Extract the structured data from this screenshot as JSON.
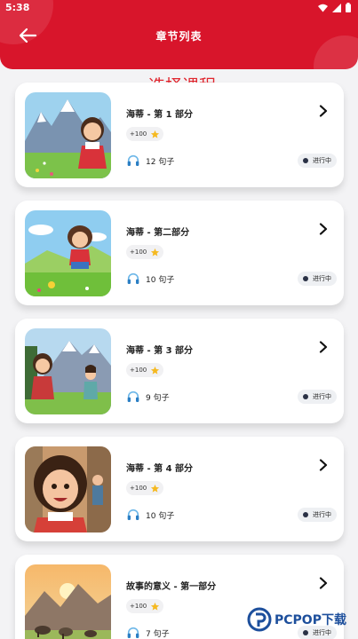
{
  "status": {
    "time": "5:38"
  },
  "header": {
    "title": "章节列表",
    "overlay": "选择课程"
  },
  "lessons": [
    {
      "title": "海蒂 - 第 1 部分",
      "points": "+100",
      "sentences": "12 句子",
      "status": "进行中",
      "scene": "alps-girl-dress"
    },
    {
      "title": "海蒂 - 第二部分",
      "points": "+100",
      "sentences": "10 句子",
      "status": "进行中",
      "scene": "running-girl-meadow"
    },
    {
      "title": "海蒂 - 第 3 部分",
      "points": "+100",
      "sentences": "9 句子",
      "status": "进行中",
      "scene": "two-girls-mountains"
    },
    {
      "title": "海蒂 - 第 4 部分",
      "points": "+100",
      "sentences": "10 句子",
      "status": "进行中",
      "scene": "girl-portrait-village"
    },
    {
      "title": "故事的意义 - 第一部分",
      "points": "+100",
      "sentences": "7 句子",
      "status": "进行中",
      "scene": "sunset-mountain-goats"
    }
  ],
  "watermark": {
    "text": "PCPOP下载",
    "subtext": "WWW.PCPOP.COM"
  },
  "colors": {
    "brand": "#d8152b",
    "overlay_title": "#e0262e",
    "status_dot": "#2a3145"
  }
}
